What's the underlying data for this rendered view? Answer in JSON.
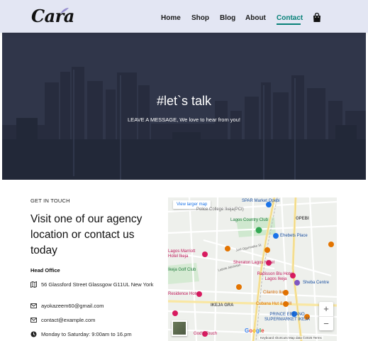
{
  "header": {
    "logo": "Cara",
    "nav": [
      "Home",
      "Shop",
      "Blog",
      "About",
      "Contact"
    ],
    "active": "Contact",
    "accent": "#088178",
    "bg": "#e3e6f3",
    "cart_icon": "shopping-bag-icon"
  },
  "hero": {
    "title": "#let`s talk",
    "subtitle": "LEAVE A MESSAGE, We love to hear from you!"
  },
  "contact": {
    "eyebrow": "GET IN TOUCH",
    "heading": "Visit one of our agency location or contact us today",
    "head_office": "Head Office",
    "address": "56 Glassford Street Glassgow G11UL New York",
    "email_primary": "ayokazeem60@gmail.com",
    "email_secondary": "contact@example.com",
    "hours": "Monday to Saturday: 9:00am to 16.pm",
    "icons": [
      "map-icon",
      "envelope-icon",
      "envelope-icon",
      "clock-icon"
    ]
  },
  "map": {
    "view_larger": "View larger map",
    "labels": {
      "spar": "SPAR Market Opebi",
      "police": "Police College Ikeja(PCI)",
      "opebi": "OPEBI",
      "lagos_club": "Lagos Country Club",
      "ehebets": "Ehebets Place",
      "marriott": "Lagos Marriott Hotel Ikeja",
      "joel": "Joel Ogunnaike St",
      "sheraton": "Sheraton Lagos Hotel",
      "golf": "Ikeja Golf Club",
      "radisson": "Radisson Blu Hotel, Lagos Ikeja",
      "latinle": "Latinle Akinlotan",
      "sheba": "Sheba Centre",
      "residence": "Residence Hotel",
      "cilantro": "Cilantro Ikeja",
      "ikeja_gra": "IKEJA GRA",
      "cubana": "Cubana Hut & Grill",
      "prince": "PRINCE EBEANO SUPERMARKET IKEJA",
      "gods_touch": "God's Touch"
    },
    "zoom_in": "+",
    "zoom_out": "−",
    "google": "Google",
    "footer": "Keyboard shortcuts    Map data ©2025    Terms"
  }
}
